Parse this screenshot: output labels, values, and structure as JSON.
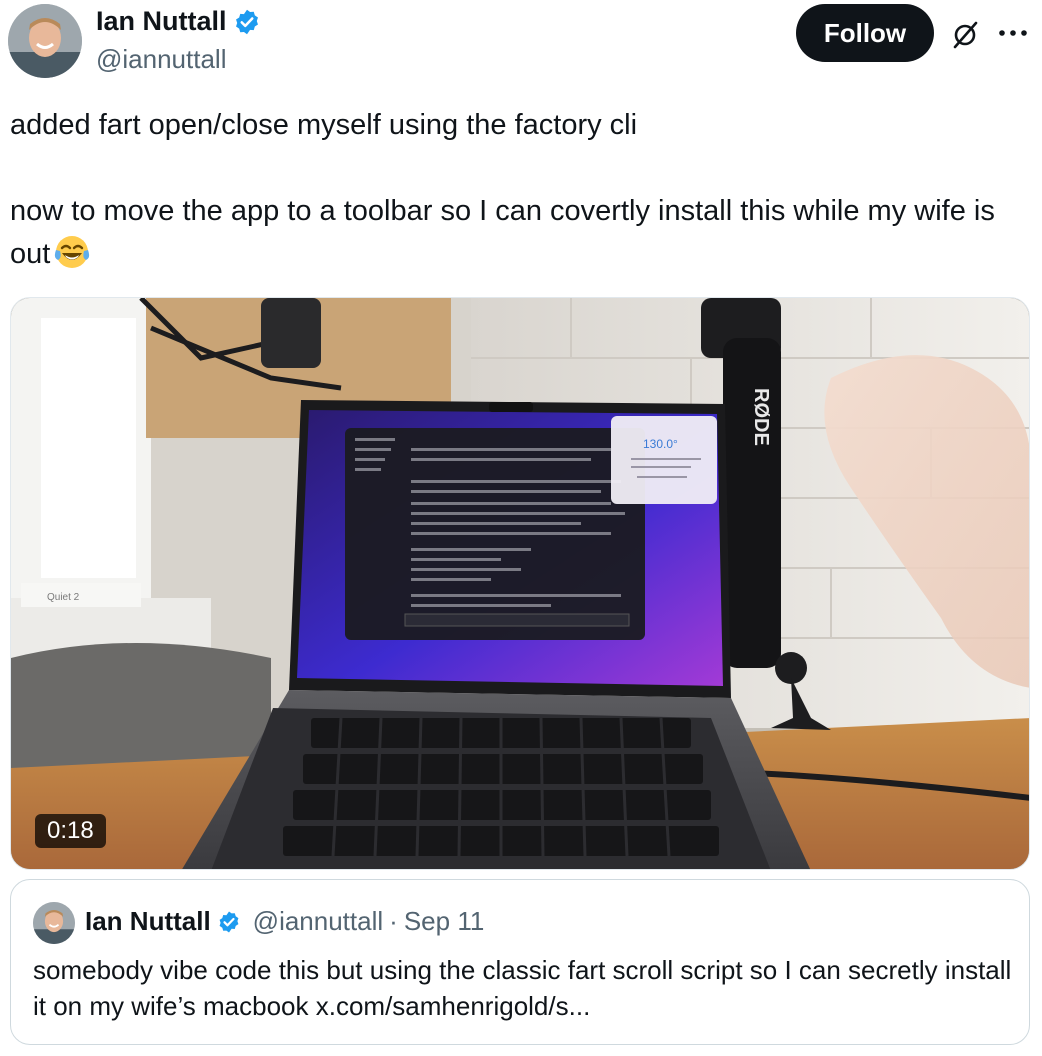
{
  "author": {
    "name": "Ian Nuttall",
    "handle": "@iannuttall",
    "avatar_icon": "profile-photo"
  },
  "actions": {
    "follow_label": "Follow",
    "grok_icon": "grok-icon",
    "more_icon": "more-icon"
  },
  "tweet": {
    "line1": "added fart open/close myself using the factory cli",
    "line2": "now to move the app to a toolbar so I can covertly install this while my wife is out",
    "emoji": "face-with-tears-of-joy"
  },
  "media": {
    "duration": "0:18",
    "screen_temperature": "130.0°",
    "mic_brand": "RØDE",
    "box_label": "Quiet 2"
  },
  "quote": {
    "name": "Ian Nuttall",
    "handle": "@iannuttall",
    "separator": "·",
    "date": "Sep 11",
    "text": "somebody vibe code this but using the classic fart scroll script so I can secretly install it on my wife’s macbook x.com/samhenrigold/s..."
  },
  "colors": {
    "verified_blue": "#1d9bf0",
    "text_primary": "#0f1419",
    "text_secondary": "#536471"
  }
}
